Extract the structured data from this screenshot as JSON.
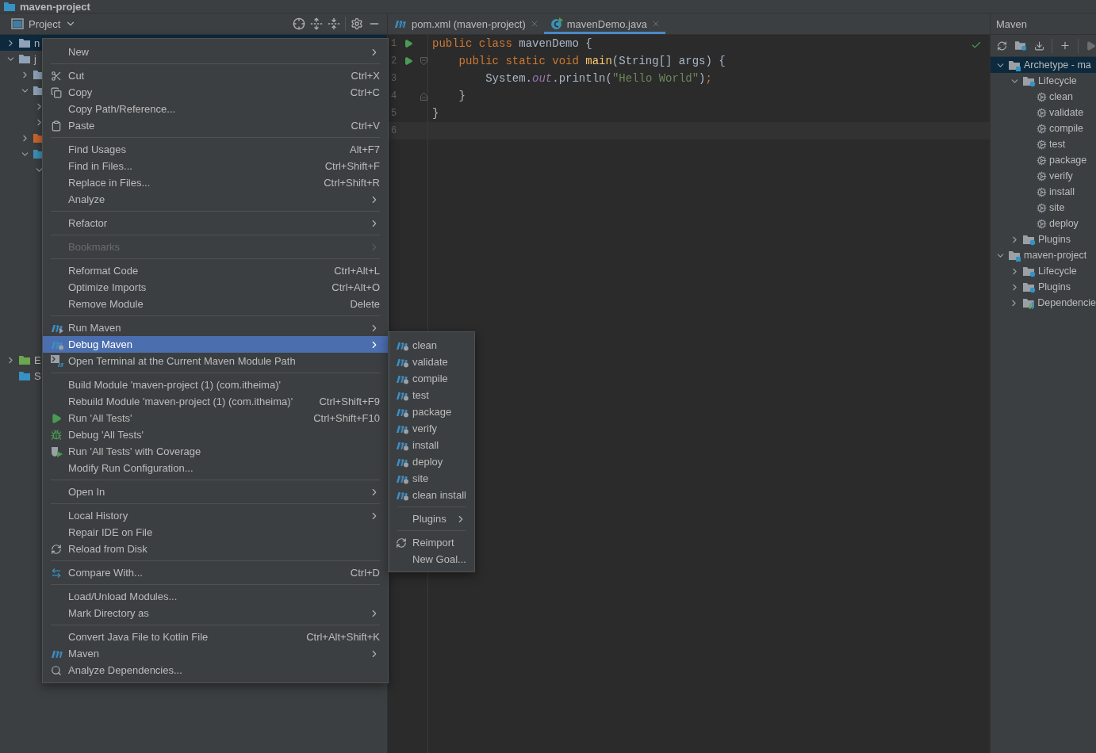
{
  "title": "maven-project",
  "project_panel": {
    "title": "Project",
    "tree": [
      {
        "label": "n",
        "expanded": false,
        "selected": true,
        "color": "#8fa3b8"
      },
      {
        "label": "j",
        "expanded": true,
        "selected": false,
        "color": "#8fa3b8",
        "children": [
          {
            "expanded": false,
            "selected": false,
            "color": "#8fa3b8"
          },
          {
            "expanded": true,
            "selected": false,
            "color": "#8fa3b8",
            "children": [
              {
                "expanded": false,
                "selected": false
              },
              {
                "expanded": false,
                "selected": false
              }
            ]
          },
          {
            "expanded": false,
            "selected": false,
            "color": "#c7662d"
          },
          {
            "expanded": true,
            "selected": false,
            "color": "#3d8fb5",
            "children": [
              {
                "expanded": true,
                "selected": false
              }
            ]
          }
        ]
      },
      {
        "label": "E",
        "expanded": false,
        "selected": false,
        "color": "#6aa84f"
      },
      {
        "label": "S",
        "selected": false,
        "color": "#3592c4"
      }
    ]
  },
  "editor": {
    "tabs": [
      {
        "label": "pom.xml (maven-project)",
        "kind": "maven",
        "selected": false
      },
      {
        "label": "mavenDemo.java",
        "kind": "java",
        "selected": true
      }
    ],
    "lines": [
      {
        "number": "1",
        "run": true,
        "tokens": [
          {
            "text": "public class",
            "kind": "keyword"
          },
          {
            "text": " mavenDemo {",
            "kind": "plain"
          }
        ]
      },
      {
        "number": "2",
        "run": true,
        "fold_start": true,
        "tokens": [
          {
            "text": "    public static void",
            "kind": "keyword"
          },
          {
            "text": " main",
            "kind": "method"
          },
          {
            "text": "(String[] args) {",
            "kind": "plain"
          }
        ]
      },
      {
        "number": "3",
        "run": false,
        "tokens": [
          {
            "text": "        System.",
            "kind": "plain"
          },
          {
            "text": "out",
            "kind": "static"
          },
          {
            "text": ".println(",
            "kind": "plain"
          },
          {
            "text": "\"Hello World\"",
            "kind": "string"
          },
          {
            "text": ")",
            "kind": "plain"
          },
          {
            "text": ";",
            "kind": "keyword"
          }
        ]
      },
      {
        "number": "4",
        "run": false,
        "fold_end": true,
        "tokens": [
          {
            "text": "    }",
            "kind": "plain"
          }
        ]
      },
      {
        "number": "5",
        "run": false,
        "tokens": [
          {
            "text": "}",
            "kind": "plain"
          }
        ]
      },
      {
        "number": "6",
        "run": false,
        "current": true
      }
    ]
  },
  "context_menu": {
    "groups": [
      [
        {
          "label": "New",
          "submenu": true,
          "disabled": false,
          "selected": false
        }
      ],
      [
        {
          "label": "Cut",
          "shortcut": "Ctrl+X",
          "submenu": false,
          "disabled": false,
          "selected": false
        },
        {
          "label": "Copy",
          "shortcut": "Ctrl+C",
          "submenu": false,
          "disabled": false,
          "selected": false
        },
        {
          "label": "Copy Path/Reference...",
          "submenu": false,
          "disabled": false,
          "selected": false
        },
        {
          "label": "Paste",
          "shortcut": "Ctrl+V",
          "submenu": false,
          "disabled": false,
          "selected": false
        }
      ],
      [
        {
          "label": "Find Usages",
          "shortcut": "Alt+F7",
          "submenu": false,
          "disabled": false,
          "selected": false
        },
        {
          "label": "Find in Files...",
          "shortcut": "Ctrl+Shift+F",
          "submenu": false,
          "disabled": false,
          "selected": false
        },
        {
          "label": "Replace in Files...",
          "shortcut": "Ctrl+Shift+R",
          "submenu": false,
          "disabled": false,
          "selected": false
        },
        {
          "label": "Analyze",
          "submenu": true,
          "disabled": false,
          "selected": false
        }
      ],
      [
        {
          "label": "Refactor",
          "submenu": true,
          "disabled": false,
          "selected": false
        }
      ],
      [
        {
          "label": "Bookmarks",
          "submenu": true,
          "disabled": true,
          "selected": false
        }
      ],
      [
        {
          "label": "Reformat Code",
          "shortcut": "Ctrl+Alt+L",
          "submenu": false,
          "disabled": false,
          "selected": false
        },
        {
          "label": "Optimize Imports",
          "shortcut": "Ctrl+Alt+O",
          "submenu": false,
          "disabled": false,
          "selected": false
        },
        {
          "label": "Remove Module",
          "shortcut": "Delete",
          "submenu": false,
          "disabled": false,
          "selected": false
        }
      ],
      [
        {
          "label": "Run Maven",
          "submenu": true,
          "disabled": false,
          "selected": false
        },
        {
          "label": "Debug Maven",
          "submenu": true,
          "disabled": false,
          "selected": true
        },
        {
          "label": "Open Terminal at the Current Maven Module Path",
          "submenu": false,
          "disabled": false,
          "selected": false
        }
      ],
      [
        {
          "label": "Build Module 'maven-project (1) (com.itheima)'",
          "submenu": false,
          "disabled": false,
          "selected": false
        },
        {
          "label": "Rebuild Module 'maven-project (1) (com.itheima)'",
          "shortcut": "Ctrl+Shift+F9",
          "submenu": false,
          "disabled": false,
          "selected": false
        },
        {
          "label": "Run 'All Tests'",
          "shortcut": "Ctrl+Shift+F10",
          "submenu": false,
          "disabled": false,
          "selected": false
        },
        {
          "label": "Debug 'All Tests'",
          "submenu": false,
          "disabled": false,
          "selected": false
        },
        {
          "label": "Run 'All Tests' with Coverage",
          "submenu": false,
          "disabled": false,
          "selected": false
        },
        {
          "label": "Modify Run Configuration...",
          "submenu": false,
          "disabled": false,
          "selected": false
        }
      ],
      [
        {
          "label": "Open In",
          "submenu": true,
          "disabled": false,
          "selected": false
        }
      ],
      [
        {
          "label": "Local History",
          "submenu": true,
          "disabled": false,
          "selected": false
        },
        {
          "label": "Repair IDE on File",
          "submenu": false,
          "disabled": false,
          "selected": false
        },
        {
          "label": "Reload from Disk",
          "submenu": false,
          "disabled": false,
          "selected": false
        }
      ],
      [
        {
          "label": "Compare With...",
          "shortcut": "Ctrl+D",
          "submenu": false,
          "disabled": false,
          "selected": false
        }
      ],
      [
        {
          "label": "Load/Unload Modules...",
          "submenu": false,
          "disabled": false,
          "selected": false
        },
        {
          "label": "Mark Directory as",
          "submenu": true,
          "disabled": false,
          "selected": false
        }
      ],
      [
        {
          "label": "Convert Java File to Kotlin File",
          "shortcut": "Ctrl+Alt+Shift+K",
          "submenu": false,
          "disabled": false,
          "selected": false
        },
        {
          "label": "Maven",
          "submenu": true,
          "disabled": false,
          "selected": false
        },
        {
          "label": "Analyze Dependencies...",
          "submenu": false,
          "disabled": false,
          "selected": false
        }
      ]
    ]
  },
  "submenu": {
    "groups": [
      [
        {
          "label": "clean",
          "submenu": false
        },
        {
          "label": "validate",
          "submenu": false
        },
        {
          "label": "compile",
          "submenu": false
        },
        {
          "label": "test",
          "submenu": false
        },
        {
          "label": "package",
          "submenu": false
        },
        {
          "label": "verify",
          "submenu": false
        },
        {
          "label": "install",
          "submenu": false
        },
        {
          "label": "deploy",
          "submenu": false
        },
        {
          "label": "site",
          "submenu": false
        },
        {
          "label": "clean install",
          "submenu": false
        }
      ],
      [
        {
          "label": "Plugins",
          "submenu": true
        }
      ],
      [
        {
          "label": "Reimport",
          "submenu": false
        },
        {
          "label": "New Goal...",
          "submenu": false
        }
      ]
    ]
  },
  "maven_panel": {
    "title": "Maven",
    "tree": [
      {
        "label": "Archetype - ma",
        "kind": "module",
        "expanded": true,
        "selected": true,
        "children": [
          {
            "label": "Lifecycle",
            "kind": "folder",
            "expanded": true,
            "selected": false,
            "children": [
              {
                "label": "clean",
                "kind": "goal",
                "selected": false
              },
              {
                "label": "validate",
                "kind": "goal",
                "selected": false
              },
              {
                "label": "compile",
                "kind": "goal",
                "selected": false
              },
              {
                "label": "test",
                "kind": "goal",
                "selected": false
              },
              {
                "label": "package",
                "kind": "goal",
                "selected": false
              },
              {
                "label": "verify",
                "kind": "goal",
                "selected": false
              },
              {
                "label": "install",
                "kind": "goal",
                "selected": false
              },
              {
                "label": "site",
                "kind": "goal",
                "selected": false
              },
              {
                "label": "deploy",
                "kind": "goal",
                "selected": false
              }
            ]
          },
          {
            "label": "Plugins",
            "kind": "folder",
            "expanded": false,
            "selected": false
          }
        ]
      },
      {
        "label": "maven-project",
        "kind": "module",
        "expanded": true,
        "selected": false,
        "children": [
          {
            "label": "Lifecycle",
            "kind": "folder",
            "expanded": false,
            "selected": false
          },
          {
            "label": "Plugins",
            "kind": "folder",
            "expanded": false,
            "selected": false
          },
          {
            "label": "Dependencie",
            "kind": "dependencies",
            "expanded": false,
            "selected": false
          }
        ]
      }
    ]
  }
}
